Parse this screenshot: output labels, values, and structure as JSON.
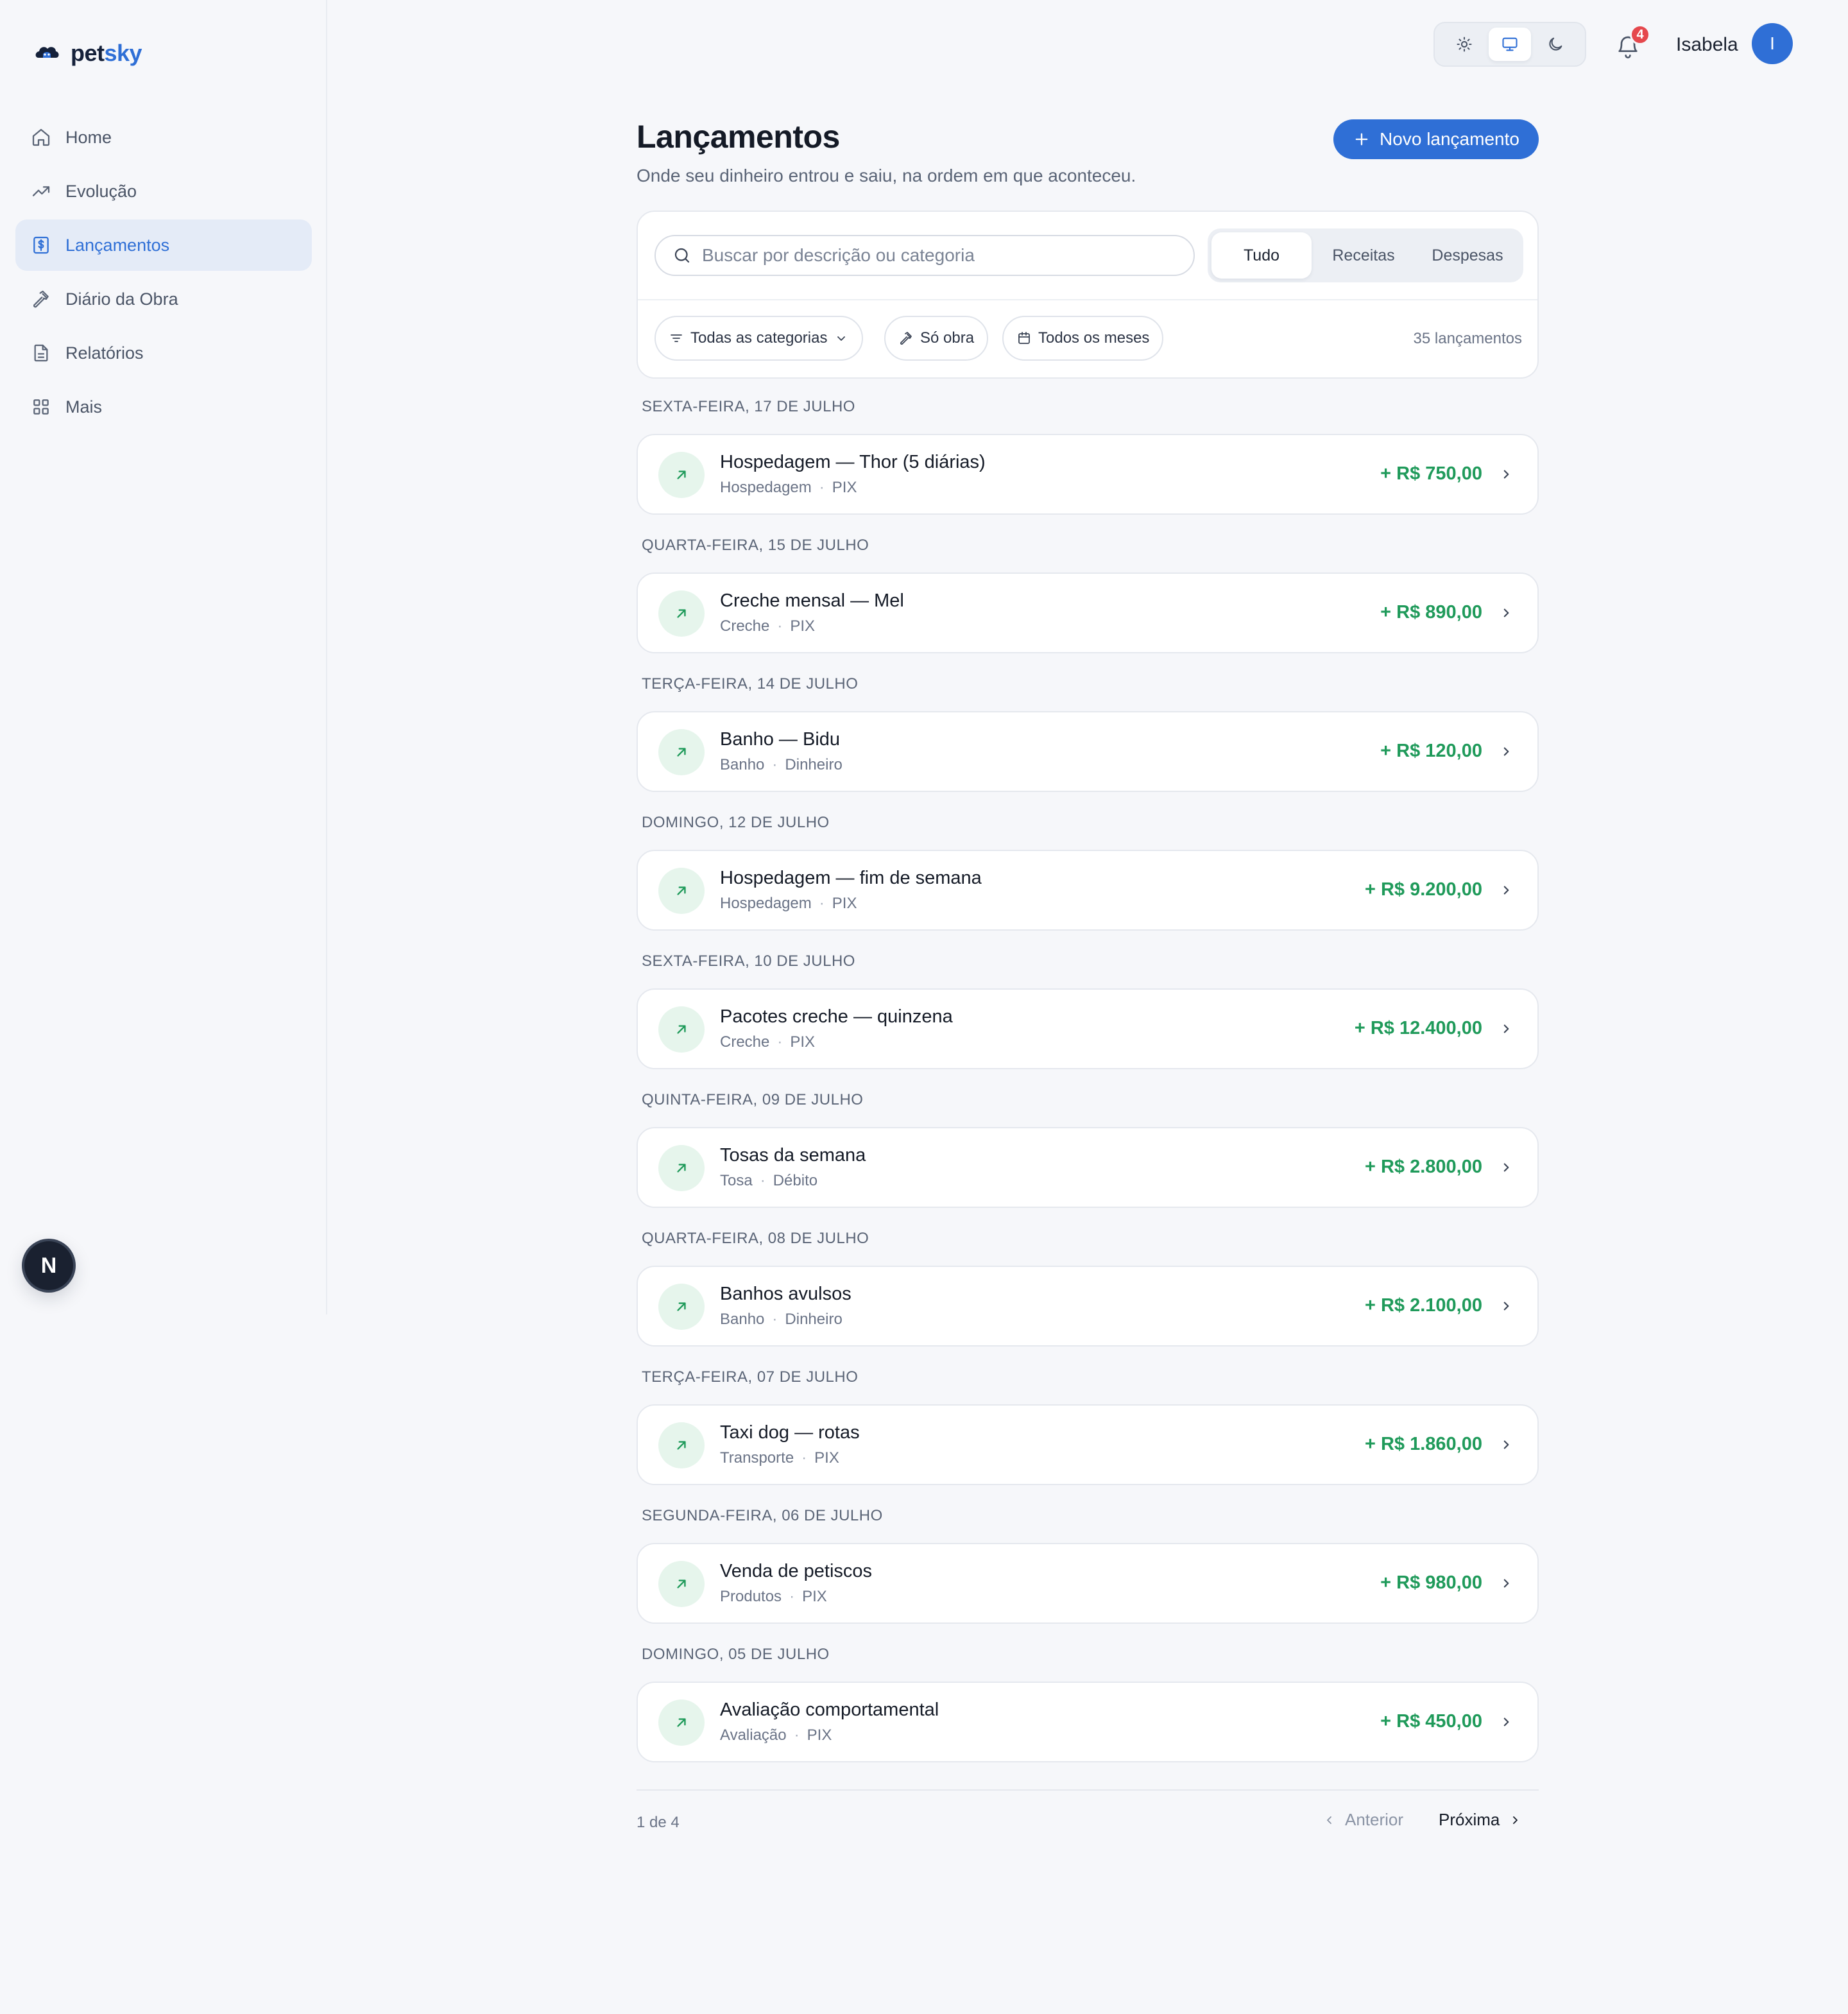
{
  "brand": {
    "part1": "pet",
    "part2": "sky"
  },
  "sidebar": {
    "items": [
      {
        "label": "Home",
        "icon": "home-icon"
      },
      {
        "label": "Evolução",
        "icon": "trending-up-icon"
      },
      {
        "label": "Lançamentos",
        "icon": "receipt-dollar-icon",
        "active": true
      },
      {
        "label": "Diário da Obra",
        "icon": "hammer-icon"
      },
      {
        "label": "Relatórios",
        "icon": "document-icon"
      },
      {
        "label": "Mais",
        "icon": "grid-icon"
      }
    ],
    "dev_badge": "N"
  },
  "topbar": {
    "theme_options": [
      "sun-icon",
      "monitor-icon",
      "moon-icon"
    ],
    "theme_active": "monitor-icon",
    "notifications_count": "4",
    "user_name": "Isabela",
    "avatar_initial": "I"
  },
  "header": {
    "title": "Lançamentos",
    "subtitle": "Onde seu dinheiro entrou e saiu, na ordem em que aconteceu.",
    "new_button": "Novo lançamento"
  },
  "filters": {
    "search_placeholder": "Buscar por descrição ou categoria",
    "segments": [
      "Tudo",
      "Receitas",
      "Despesas"
    ],
    "segment_active": "Tudo",
    "category_chip": "Todas as categorias",
    "obra_chip": "Só obra",
    "months_chip": "Todos os meses",
    "count": "35 lançamentos"
  },
  "groups": [
    {
      "date": "SEXTA-FEIRA, 17 DE JULHO",
      "tx": {
        "title": "Hospedagem — Thor (5 diárias)",
        "category": "Hospedagem",
        "method": "PIX",
        "amount": "+ R$ 750,00"
      }
    },
    {
      "date": "QUARTA-FEIRA, 15 DE JULHO",
      "tx": {
        "title": "Creche mensal — Mel",
        "category": "Creche",
        "method": "PIX",
        "amount": "+ R$ 890,00"
      }
    },
    {
      "date": "TERÇA-FEIRA, 14 DE JULHO",
      "tx": {
        "title": "Banho — Bidu",
        "category": "Banho",
        "method": "Dinheiro",
        "amount": "+ R$ 120,00"
      }
    },
    {
      "date": "DOMINGO, 12 DE JULHO",
      "tx": {
        "title": "Hospedagem — fim de semana",
        "category": "Hospedagem",
        "method": "PIX",
        "amount": "+ R$ 9.200,00"
      }
    },
    {
      "date": "SEXTA-FEIRA, 10 DE JULHO",
      "tx": {
        "title": "Pacotes creche — quinzena",
        "category": "Creche",
        "method": "PIX",
        "amount": "+ R$ 12.400,00"
      }
    },
    {
      "date": "QUINTA-FEIRA, 09 DE JULHO",
      "tx": {
        "title": "Tosas da semana",
        "category": "Tosa",
        "method": "Débito",
        "amount": "+ R$ 2.800,00"
      }
    },
    {
      "date": "QUARTA-FEIRA, 08 DE JULHO",
      "tx": {
        "title": "Banhos avulsos",
        "category": "Banho",
        "method": "Dinheiro",
        "amount": "+ R$ 2.100,00"
      }
    },
    {
      "date": "TERÇA-FEIRA, 07 DE JULHO",
      "tx": {
        "title": "Taxi dog — rotas",
        "category": "Transporte",
        "method": "PIX",
        "amount": "+ R$ 1.860,00"
      }
    },
    {
      "date": "SEGUNDA-FEIRA, 06 DE JULHO",
      "tx": {
        "title": "Venda de petiscos",
        "category": "Produtos",
        "method": "PIX",
        "amount": "+ R$ 980,00"
      }
    },
    {
      "date": "DOMINGO, 05 DE JULHO",
      "tx": {
        "title": "Avaliação comportamental",
        "category": "Avaliação",
        "method": "PIX",
        "amount": "+ R$ 450,00"
      }
    }
  ],
  "pagination": {
    "label": "1 de 4",
    "prev": "Anterior",
    "next": "Próxima"
  },
  "colors": {
    "accent": "#2f6fd6",
    "income": "#1f9a5a",
    "income_bg": "#e6f5ec",
    "background": "#f6f7fa"
  }
}
